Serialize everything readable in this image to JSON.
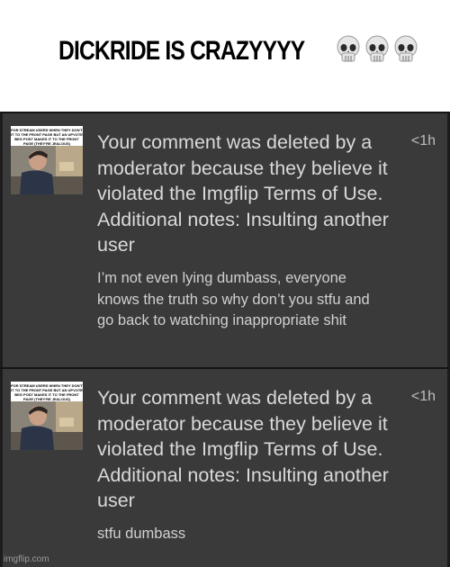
{
  "caption": {
    "text": "DICKRIDE IS CRAZYYYY",
    "emoji": [
      "skull-icon",
      "skull-icon",
      "skull-icon"
    ]
  },
  "notifications": [
    {
      "thumbnail_caption": "FOR STREAM USERS WHEN THEY DON'T IT TO THE FRONT PAGE BUT AN UPVOTE BEG POST MAKES IT TO THE FRONT PAGE (THEY'RE JEALOUS)",
      "message": "Your comment was deleted by a moderator because they believe it violated the Imgflip Terms of Use. Additional notes: Insulting another user",
      "time": "<1h",
      "comment": "I’m not even lying dumbass, everyone knows the truth so why don’t you stfu and go back to watching inappropriate shit"
    },
    {
      "thumbnail_caption": "FOR STREAM USERS WHEN THEY DON'T IT TO THE FRONT PAGE BUT AN UPVOTE BEG POST MAKES IT TO THE FRONT PAGE (THEY'RE JEALOUS)",
      "message": "Your comment was deleted by a moderator because they believe it violated the Imgflip Terms of Use. Additional notes: Insulting another user",
      "time": "<1h",
      "comment": "stfu dumbass"
    }
  ],
  "watermark": "imgflip.com",
  "colors": {
    "panel_bg": "#3a3a3a",
    "divider": "#141414",
    "text": "#d9d9d9"
  }
}
